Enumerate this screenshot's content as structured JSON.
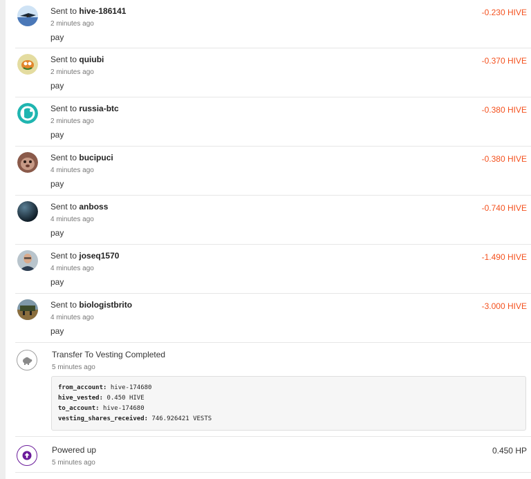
{
  "transfers": [
    {
      "prefix": "Sent to",
      "user": "hive-186141",
      "time": "2 minutes ago",
      "memo": "pay",
      "amount": "-0.230 HIVE",
      "avatar": "avatar-icon"
    },
    {
      "prefix": "Sent to",
      "user": "quiubi",
      "time": "2 minutes ago",
      "memo": "pay",
      "amount": "-0.370 HIVE",
      "avatar": "avatar-icon"
    },
    {
      "prefix": "Sent to",
      "user": "russia-btc",
      "time": "2 minutes ago",
      "memo": "pay",
      "amount": "-0.380 HIVE",
      "avatar": "avatar-icon"
    },
    {
      "prefix": "Sent to",
      "user": "bucipuci",
      "time": "4 minutes ago",
      "memo": "pay",
      "amount": "-0.380 HIVE",
      "avatar": "avatar-icon"
    },
    {
      "prefix": "Sent to",
      "user": "anboss",
      "time": "4 minutes ago",
      "memo": "pay",
      "amount": "-0.740 HIVE",
      "avatar": "avatar-icon"
    },
    {
      "prefix": "Sent to",
      "user": "joseq1570",
      "time": "4 minutes ago",
      "memo": "pay",
      "amount": "-1.490 HIVE",
      "avatar": "avatar-icon"
    },
    {
      "prefix": "Sent to",
      "user": "biologistbrito",
      "time": "4 minutes ago",
      "memo": "pay",
      "amount": "-3.000 HIVE",
      "avatar": "avatar-icon"
    }
  ],
  "vesting": {
    "title": "Transfer To Vesting Completed",
    "time": "5 minutes ago",
    "details": [
      {
        "key": "from_account:",
        "value": "hive-174680"
      },
      {
        "key": "hive_vested:",
        "value": "0.450 HIVE"
      },
      {
        "key": "to_account:",
        "value": "hive-174680"
      },
      {
        "key": "vesting_shares_received:",
        "value": "746.926421 VESTS"
      }
    ]
  },
  "power": {
    "title": "Powered up",
    "time": "5 minutes ago",
    "amount": "0.450 HP"
  },
  "colors": {
    "negative": "#f4511e",
    "accent": "#6a1b9a"
  }
}
